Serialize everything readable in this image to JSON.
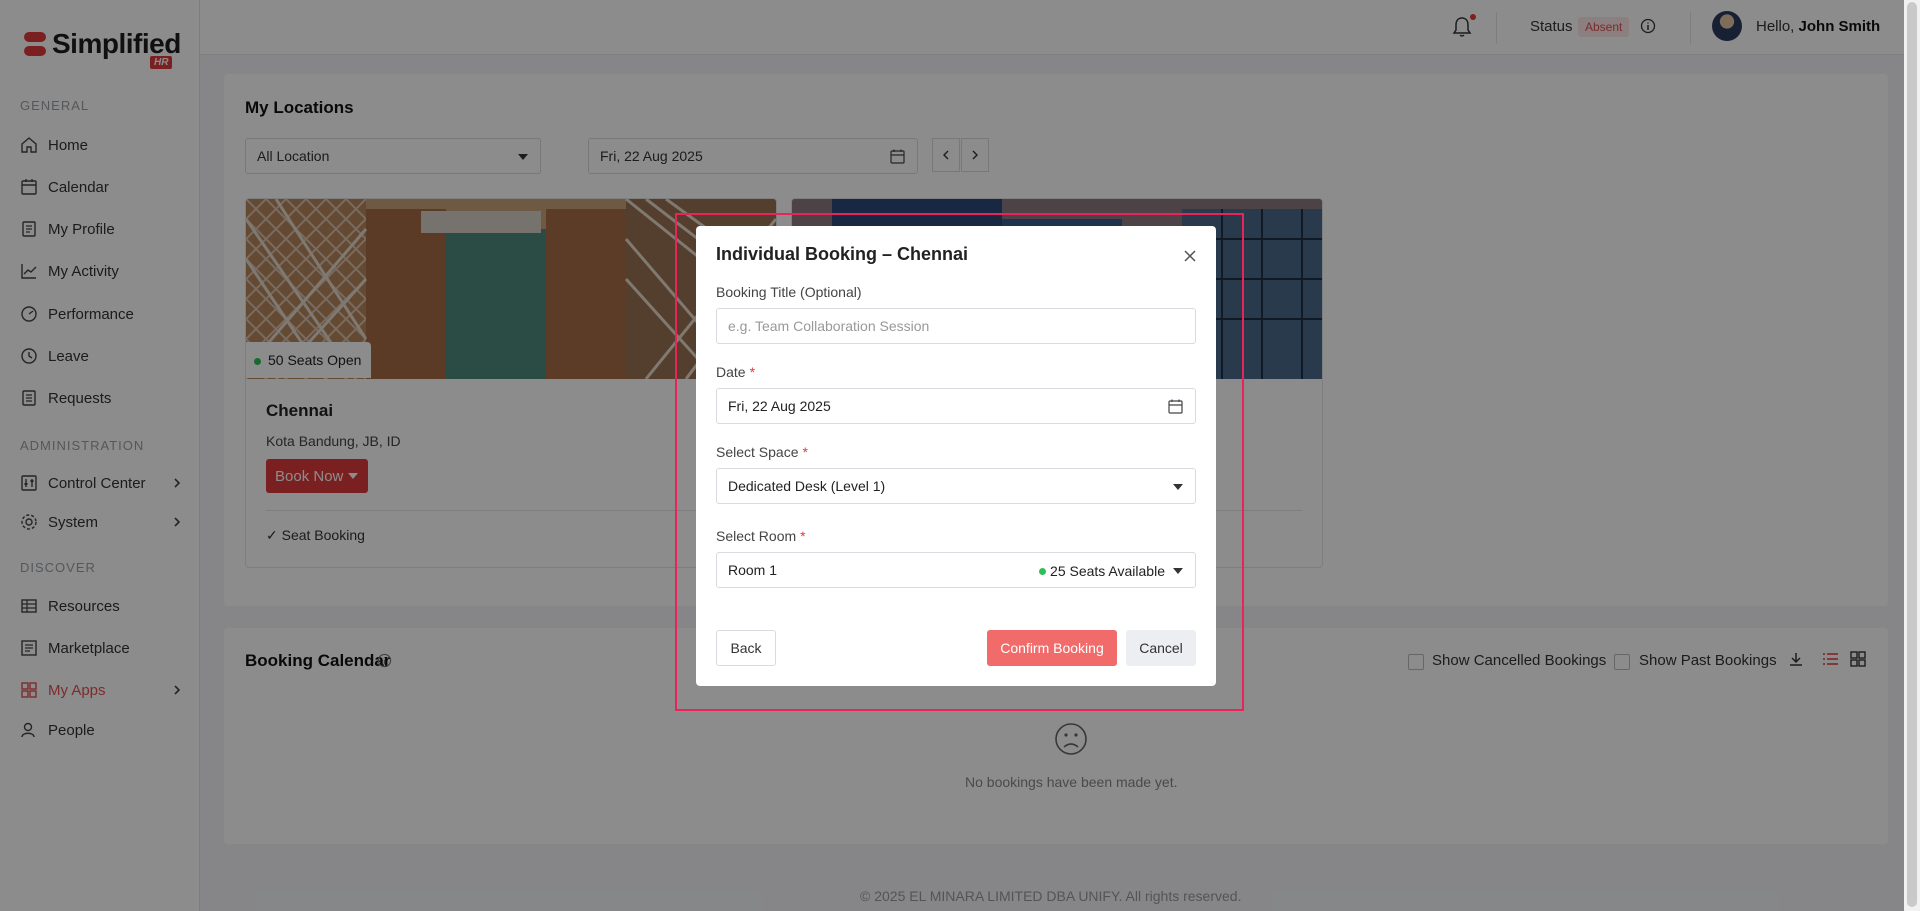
{
  "app": {
    "logo_text": "Simplified",
    "logo_badge": "HR"
  },
  "sidebar": {
    "sections": [
      {
        "label": "GENERAL"
      },
      {
        "label": "ADMINISTRATION"
      },
      {
        "label": "DISCOVER"
      }
    ],
    "items": [
      {
        "label": "Home",
        "icon": "home-icon"
      },
      {
        "label": "Calendar",
        "icon": "calendar-icon"
      },
      {
        "label": "My Profile",
        "icon": "profile-icon"
      },
      {
        "label": "My Activity",
        "icon": "activity-icon"
      },
      {
        "label": "Performance",
        "icon": "gauge-icon"
      },
      {
        "label": "Leave",
        "icon": "clock-icon"
      },
      {
        "label": "Requests",
        "icon": "document-icon"
      },
      {
        "label": "Control Center",
        "icon": "control-icon"
      },
      {
        "label": "System",
        "icon": "gear-icon"
      },
      {
        "label": "Resources",
        "icon": "table-icon"
      },
      {
        "label": "Marketplace",
        "icon": "store-icon"
      },
      {
        "label": "My Apps",
        "icon": "grid-icon",
        "active": true
      },
      {
        "label": "People",
        "icon": "people-icon"
      }
    ]
  },
  "topbar": {
    "status_label": "Status",
    "status_value": "Absent",
    "greeting": "Hello,",
    "user_name": "John Smith"
  },
  "locations": {
    "title": "My Locations",
    "location_filter": "All Location",
    "date": "Fri, 22 Aug 2025",
    "cards": [
      {
        "seats": "50 Seats Open",
        "name": "Chennai",
        "address": "Kota Bandung, JB, ID",
        "book_label": "Book Now",
        "feature": "✓ Seat Booking"
      }
    ]
  },
  "booking_calendar": {
    "title": "Booking Calendar",
    "show_cancelled": "Show Cancelled Bookings",
    "show_past": "Show Past Bookings",
    "empty_text": "No bookings have been made yet."
  },
  "footer": {
    "copyright": "© 2025 EL MINARA LIMITED DBA UNIFY. All rights reserved."
  },
  "modal": {
    "title": "Individual Booking – Chennai",
    "booking_title_label": "Booking Title (Optional)",
    "booking_title_placeholder": "e.g. Team Collaboration Session",
    "date_label": "Date",
    "date_value": "Fri, 22 Aug 2025",
    "space_label": "Select Space",
    "space_value": "Dedicated Desk (Level 1)",
    "room_label": "Select Room",
    "room_value": "Room 1",
    "room_availability": "25 Seats Available",
    "required_mark": "*",
    "back_label": "Back",
    "confirm_label": "Confirm Booking",
    "cancel_label": "Cancel"
  },
  "colors": {
    "brand": "#e03b3b",
    "confirm": "#f26b6b",
    "available": "#2fbf57",
    "highlight": "#e8245a"
  }
}
